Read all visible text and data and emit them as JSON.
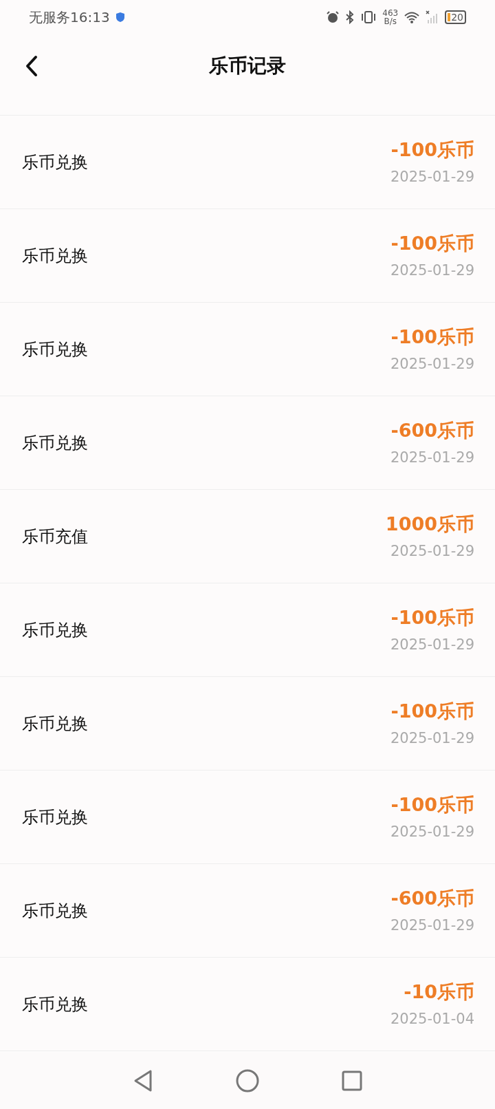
{
  "status_bar": {
    "carrier": "无服务",
    "time": "16:13",
    "network_speed": "463",
    "network_speed_unit": "B/s",
    "battery": "20"
  },
  "header": {
    "title": "乐币记录"
  },
  "records": [
    {
      "name": "乐币兑换",
      "amount": "-100乐币",
      "date": "2025-01-29"
    },
    {
      "name": "乐币兑换",
      "amount": "-100乐币",
      "date": "2025-01-29"
    },
    {
      "name": "乐币兑换",
      "amount": "-100乐币",
      "date": "2025-01-29"
    },
    {
      "name": "乐币兑换",
      "amount": "-600乐币",
      "date": "2025-01-29"
    },
    {
      "name": "乐币充值",
      "amount": "1000乐币",
      "date": "2025-01-29"
    },
    {
      "name": "乐币兑换",
      "amount": "-100乐币",
      "date": "2025-01-29"
    },
    {
      "name": "乐币兑换",
      "amount": "-100乐币",
      "date": "2025-01-29"
    },
    {
      "name": "乐币兑换",
      "amount": "-100乐币",
      "date": "2025-01-29"
    },
    {
      "name": "乐币兑换",
      "amount": "-600乐币",
      "date": "2025-01-29"
    },
    {
      "name": "乐币兑换",
      "amount": "-10乐币",
      "date": "2025-01-04"
    }
  ]
}
